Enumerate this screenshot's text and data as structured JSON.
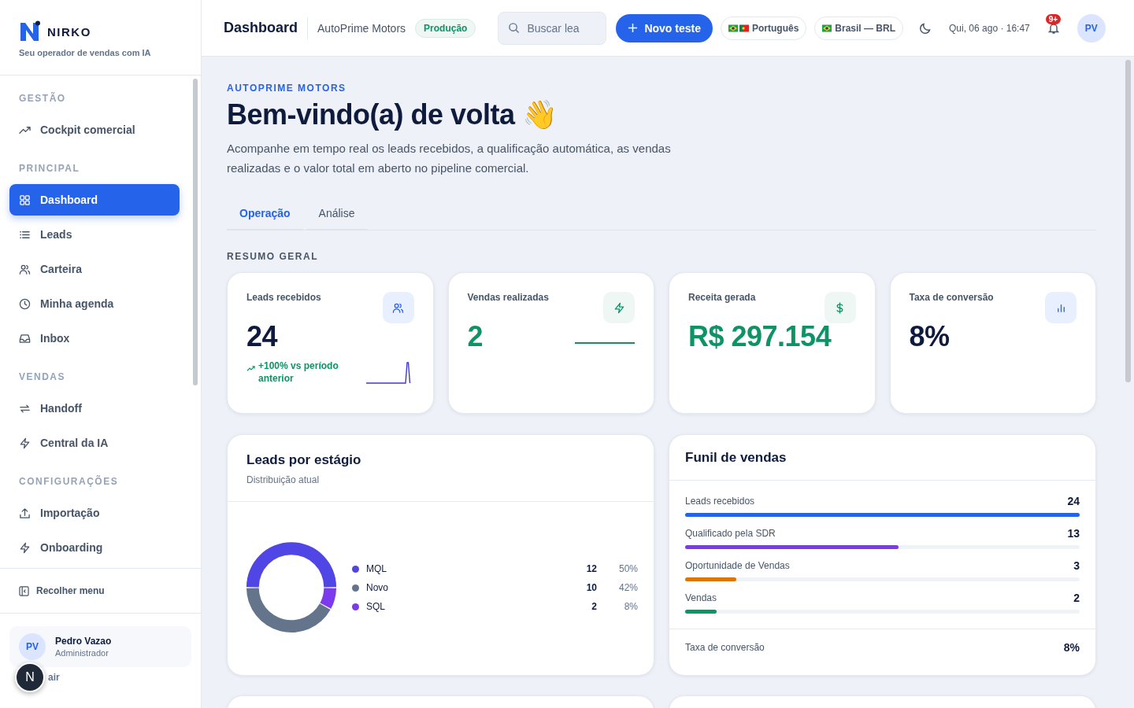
{
  "brand": {
    "name": "NIRKO",
    "tagline": "Seu operador de vendas com IA"
  },
  "sidebar": {
    "sections": [
      {
        "title": "GESTÃO",
        "items": [
          {
            "label": "Cockpit comercial",
            "selected": false
          }
        ]
      },
      {
        "title": "PRINCIPAL",
        "items": [
          {
            "label": "Dashboard",
            "selected": true
          },
          {
            "label": "Leads",
            "selected": false
          },
          {
            "label": "Carteira",
            "selected": false
          },
          {
            "label": "Minha agenda",
            "selected": false
          },
          {
            "label": "Inbox",
            "selected": false
          }
        ]
      },
      {
        "title": "VENDAS",
        "items": [
          {
            "label": "Handoff",
            "selected": false
          },
          {
            "label": "Central da IA",
            "selected": false
          }
        ]
      },
      {
        "title": "CONFIGURAÇÕES",
        "items": [
          {
            "label": "Importação",
            "selected": false
          },
          {
            "label": "Onboarding",
            "selected": false
          }
        ]
      }
    ],
    "collapse": "Recolher menu",
    "user": {
      "initials": "PV",
      "name": "Pedro Vazao",
      "role": "Administrador"
    },
    "logout": "air",
    "chat_bubble": "N"
  },
  "header": {
    "title": "Dashboard",
    "company": "AutoPrime Motors",
    "env_badge": "Produção",
    "search": {
      "placeholder": "Buscar lea"
    },
    "new_button": "Novo teste",
    "language": "Português",
    "region": "Brasil — BRL",
    "datetime": "Qui, 06 ago · 16:47",
    "notifications": "9+",
    "avatar": "PV"
  },
  "hero": {
    "eyebrow": "AUTOPRIME MOTORS",
    "title": "Bem-vindo(a) de volta",
    "emoji": "👋",
    "description": "Acompanhe em tempo real os leads recebidos, a qualificação automática, as vendas realizadas e o valor total em aberto no pipeline comercial."
  },
  "tabs": [
    {
      "label": "Operação",
      "selected": true
    },
    {
      "label": "Análise",
      "selected": false
    }
  ],
  "section_title": "RESUMO GERAL",
  "stats": [
    {
      "label": "Leads recebidos",
      "value": "24",
      "kind": "leads",
      "trend": "+100% vs período anterior"
    },
    {
      "label": "Vendas realizadas",
      "value": "2",
      "kind": "sales"
    },
    {
      "label": "Receita gerada",
      "value": "R$ 297.154",
      "kind": "revenue"
    },
    {
      "label": "Taxa de conversão",
      "value": "8%",
      "kind": "rate"
    }
  ],
  "stage_card": {
    "title": "Leads por estágio",
    "subtitle": "Distribuição atual",
    "chart_data": {
      "type": "donut",
      "categories": [
        "MQL",
        "Novo",
        "SQL"
      ],
      "values": [
        50,
        42,
        8
      ]
    },
    "legend": [
      {
        "count": "12",
        "percent": "50%",
        "color": "#4f46e5"
      },
      {
        "count": "10",
        "percent": "42%",
        "color": "#64748b"
      },
      {
        "count": "2",
        "percent": "8%",
        "color": "#7c3aed"
      }
    ]
  },
  "funnel": {
    "title": "Funil de vendas",
    "rows": [
      {
        "label": "Leads recebidos",
        "value": "24",
        "level": 1,
        "color": "#2563eb"
      },
      {
        "label": "Qualificado pela SDR",
        "value": "13",
        "level": 0.54,
        "color": "#7c3aed"
      },
      {
        "label": "Oportunidade de Vendas",
        "value": "3",
        "level": 0.13,
        "color": "#d97706"
      },
      {
        "label": "Vendas",
        "value": "2",
        "level": 0.08,
        "color": "#059669"
      }
    ],
    "footer_label": "Taxa de conversão",
    "footer_value": "8%"
  }
}
